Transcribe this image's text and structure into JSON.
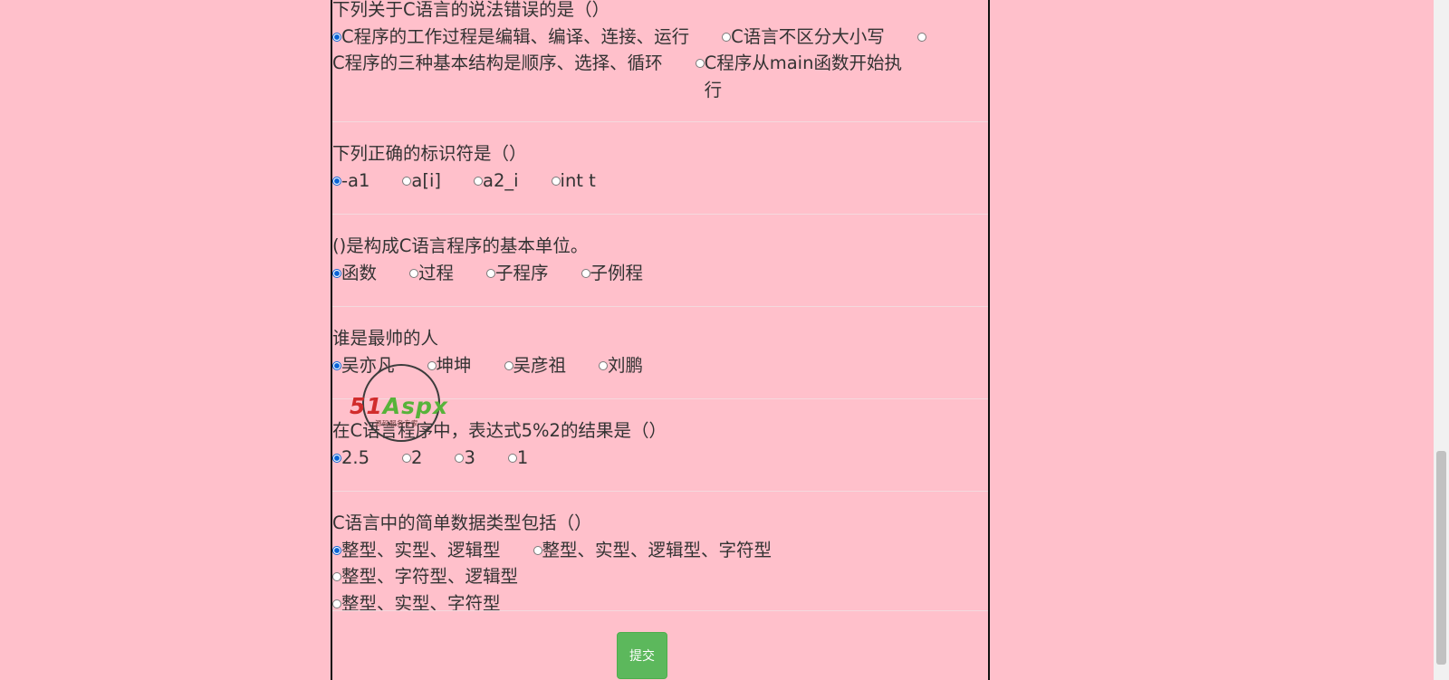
{
  "questions": [
    {
      "title": "下列关于C语言的说法错误的是（）",
      "options": [
        "C程序的工作过程是编辑、编译、连接、运行",
        "C语言不区分大小写",
        "C程序的三种基本结构是顺序、选择、循环",
        "C程序从main函数开始执行"
      ],
      "selected_index": 0
    },
    {
      "title": "下列正确的标识符是（）",
      "options": [
        "-a1",
        "a[i]",
        "a2_i",
        "int t"
      ],
      "selected_index": 0
    },
    {
      "title": "()是构成C语言程序的基本单位。",
      "options": [
        "函数",
        "过程",
        "子程序",
        "子例程"
      ],
      "selected_index": 0
    },
    {
      "title": "谁是最帅的人",
      "options": [
        "吴亦凡",
        "坤坤",
        "吴彦祖",
        "刘鹏"
      ],
      "selected_index": 0
    },
    {
      "title": "在C语言程序中，表达式5%2的结果是（）",
      "options": [
        "2.5",
        "2",
        "3",
        "1"
      ],
      "selected_index": 0
    },
    {
      "title": "C语言中的简单数据类型包括（）",
      "options": [
        "整型、实型、逻辑型",
        "整型、实型、逻辑型、字符型",
        "整型、字符型、逻辑型",
        "整型、实型、字符型"
      ],
      "selected_index": 0
    }
  ],
  "submit_label": "提交",
  "watermark": {
    "brand_part1": "51",
    "brand_part2": "Aspx",
    "tagline": "源码服务专家"
  },
  "colors": {
    "page_background": "#ffc0cb",
    "submit_button": "#5cb85c",
    "radio_checked": "#0a64d6"
  }
}
